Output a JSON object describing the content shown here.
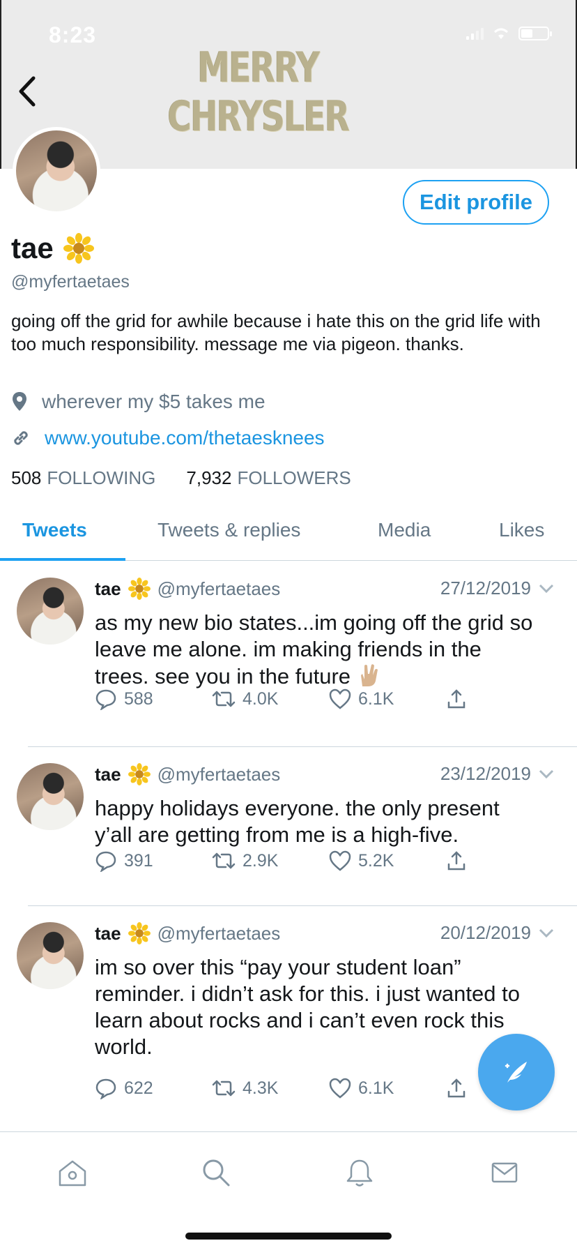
{
  "status_bar": {
    "time": "8:23"
  },
  "header": {
    "banner_text": "MERRY CHRYSLER"
  },
  "profile": {
    "name": "tae",
    "handle": "@myfertaetaes",
    "edit_label": "Edit profile",
    "bio": "going off the grid for awhile because i hate this on the grid life with too much responsibility. message me via pigeon. thanks.",
    "location": "wherever my $5 takes me",
    "url": "www.youtube.com/thetaesknees",
    "following_count": "508",
    "following_label": "FOLLOWING",
    "followers_count": "7,932",
    "followers_label": "FOLLOWERS"
  },
  "tabs": [
    {
      "label": "Tweets",
      "active": true
    },
    {
      "label": "Tweets & replies",
      "active": false
    },
    {
      "label": "Media",
      "active": false
    },
    {
      "label": "Likes",
      "active": false
    }
  ],
  "tweets": [
    {
      "name": "tae",
      "handle": "@myfertaetaes",
      "date": "27/12/2019",
      "text": "as my new bio states...im going off the grid so leave me alone. im making friends in the trees. see you in the future",
      "replies": "588",
      "retweets": "4.0K",
      "likes": "6.1K"
    },
    {
      "name": "tae",
      "handle": "@myfertaetaes",
      "date": "23/12/2019",
      "text": "happy holidays everyone. the only present y’all are getting from me is a high-five.",
      "replies": "391",
      "retweets": "2.9K",
      "likes": "5.2K"
    },
    {
      "name": "tae",
      "handle": "@myfertaetaes",
      "date": "20/12/2019",
      "text": "im so over this “pay your student loan” reminder. i didn’t ask for this. i just wanted to learn about rocks and i can’t even rock this world.",
      "replies": "622",
      "retweets": "4.3K",
      "likes": "6.1K"
    }
  ],
  "colors": {
    "accent": "#1da1f2",
    "link": "#1b95e0",
    "secondary_text": "#657786",
    "compose": "#4aa8ee"
  },
  "icons": [
    "back-arrow-icon",
    "flower-emoji-icon",
    "location-pin-icon",
    "link-icon",
    "reply-icon",
    "retweet-icon",
    "like-icon",
    "share-icon",
    "chevron-down-icon",
    "vulcan-salute-emoji-icon",
    "compose-feather-icon",
    "home-icon",
    "search-icon",
    "notifications-bell-icon",
    "messages-mail-icon"
  ]
}
